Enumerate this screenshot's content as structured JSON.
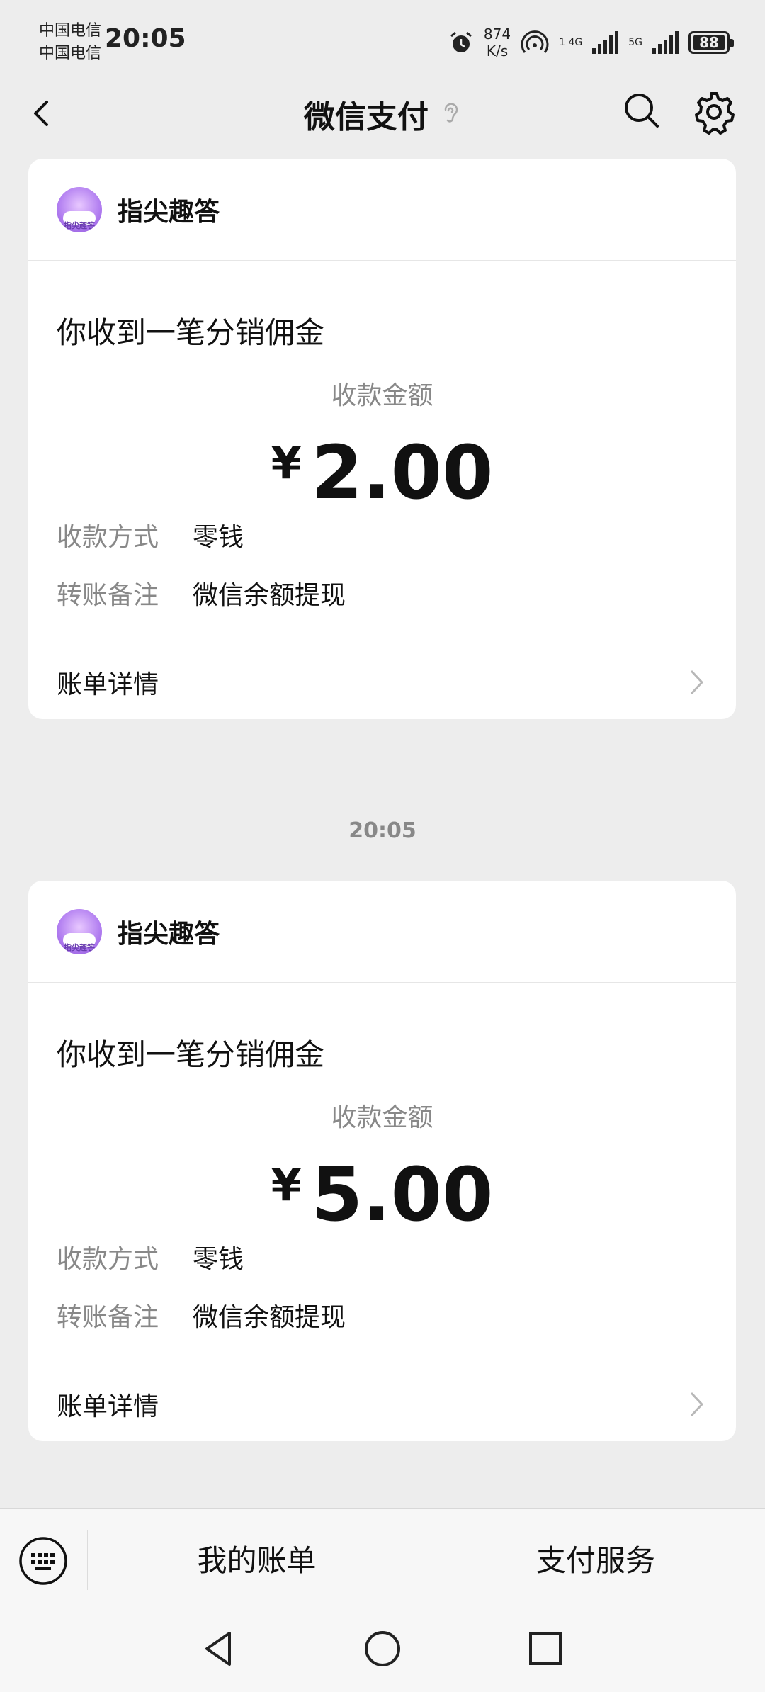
{
  "status_bar": {
    "carrier_1": "中国电信",
    "carrier_2": "中国电信",
    "time": "20:05",
    "net_speed_value": "874",
    "net_speed_unit": "K/s",
    "sim1_label": "1 4G",
    "sim2_label": "5G",
    "battery": "88"
  },
  "nav": {
    "title": "微信支付",
    "icons": [
      "back-icon",
      "ear-icon",
      "search-icon",
      "gear-icon"
    ]
  },
  "cards": [
    {
      "merchant": "指尖趣答",
      "avatar_text": "指尖趣答",
      "headline": "你收到一笔分销佣金",
      "amount_label": "收款金额",
      "currency": "¥",
      "amount": "2.00",
      "method_label": "收款方式",
      "method_value": "零钱",
      "note_label": "转账备注",
      "note_value": "微信余额提现",
      "detail_label": "账单详情"
    },
    {
      "merchant": "指尖趣答",
      "avatar_text": "指尖趣答",
      "headline": "你收到一笔分销佣金",
      "amount_label": "收款金额",
      "currency": "¥",
      "amount": "5.00",
      "method_label": "收款方式",
      "method_value": "零钱",
      "note_label": "转账备注",
      "note_value": "微信余额提现",
      "detail_label": "账单详情"
    }
  ],
  "timestamp": "20:05",
  "bottom_bar": {
    "my_bills": "我的账单",
    "payment_services": "支付服务"
  },
  "colors": {
    "background": "#ededed",
    "card": "#ffffff",
    "label_gray": "#888888",
    "text": "#111111"
  }
}
